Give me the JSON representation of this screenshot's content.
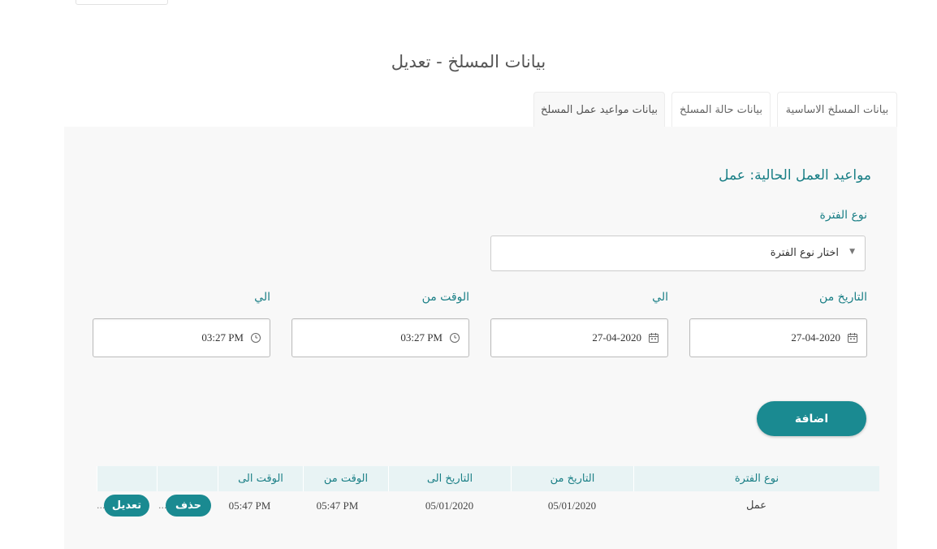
{
  "page": {
    "title": "بيانات المسلخ - تعديل"
  },
  "tabs": [
    {
      "label": "بيانات المسلخ الاساسية",
      "active": false
    },
    {
      "label": "بيانات حالة المسلخ",
      "active": false
    },
    {
      "label": "بيانات مواعيد عمل المسلخ",
      "active": true
    }
  ],
  "section": {
    "heading": "مواعيد العمل الحالية: عمل"
  },
  "period_type": {
    "label": "نوع الفترة",
    "selected": "اختار نوع الفترة"
  },
  "fields": {
    "date_from": {
      "label": "التاريخ من",
      "value": "27-04-2020"
    },
    "date_to": {
      "label": "الي",
      "value": "27-04-2020"
    },
    "time_from": {
      "label": "الوقت من",
      "value": "03:27 PM"
    },
    "time_to": {
      "label": "الي",
      "value": "03:27 PM"
    }
  },
  "add_button": {
    "label": "اضافة"
  },
  "table": {
    "columns": [
      "نوع الفترة",
      "التاريخ من",
      "التاريخ الى",
      "الوقت من",
      "الوقت الى",
      "",
      ""
    ],
    "rows": [
      {
        "type": "عمل",
        "date_from": "05/01/2020",
        "date_to": "05/01/2020",
        "time_from": "05:47 PM",
        "time_to": "05:47 PM",
        "delete_label": "حذف",
        "edit_label": "تعديل",
        "ellipsis": "..."
      }
    ]
  },
  "colors": {
    "accent": "#1a8a91",
    "heading": "#1a7f86",
    "panel_bg": "#f8f8f8",
    "table_head_bg": "#e8f3f4"
  },
  "icons": {
    "calendar": "calendar-icon",
    "clock": "clock-icon",
    "caret": "caret-down-icon"
  }
}
